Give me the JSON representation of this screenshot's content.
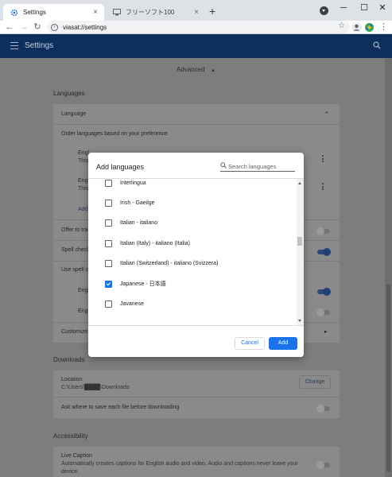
{
  "browser": {
    "tabs": [
      {
        "title": "Settings",
        "active": true
      },
      {
        "title": "フリーソフト100",
        "active": false
      }
    ],
    "new_tab": "+",
    "window": {
      "minimize": "─",
      "maximize": "☐",
      "close": "✕"
    },
    "nav": {
      "back": "←",
      "forward": "→",
      "reload": "↻"
    },
    "url": "viasat://settings",
    "info_glyph": "i",
    "star": "☆",
    "menu": "⋮"
  },
  "settings": {
    "app_title": "Settings",
    "advanced_label": "Advanced",
    "advanced_arrow": "▲",
    "languages_heading": "Languages",
    "language_label": "Language",
    "language_chevron": "⌃",
    "order_label": "Order languages based on your preference",
    "lang1_title": "Engl",
    "lang1_sub": "This",
    "lang2_title": "Engl",
    "lang2_sub": "This",
    "add_link": "Add",
    "offer_translate": "Offer to tra",
    "spell_check": "Spell check",
    "use_spell": "Use spell c",
    "spell_lang1": "Engl",
    "spell_lang2": "Engl",
    "customize": "Customize",
    "downloads_heading": "Downloads",
    "location_label": "Location",
    "location_path": "C:\\Users\\████\\Downloads",
    "change_button": "Change",
    "ask_where": "Ask where to save each file before downloading",
    "accessibility_heading": "Accessibility",
    "live_caption": "Live Caption",
    "live_caption_desc": "Automatically creates captions for English audio and video. Audio and captions never leave your",
    "live_caption_desc2": "device."
  },
  "dialog": {
    "title": "Add languages",
    "search_placeholder": "Search languages",
    "languages": [
      {
        "label": "Interlingua",
        "checked": false
      },
      {
        "label": "Irish - Gaeilge",
        "checked": false
      },
      {
        "label": "Italian - italiano",
        "checked": false
      },
      {
        "label": "Italian (Italy) - italiano (Italia)",
        "checked": false
      },
      {
        "label": "Italian (Switzerland) - italiano (Svizzera)",
        "checked": false
      },
      {
        "label": "Japanese - 日本語",
        "checked": true
      },
      {
        "label": "Javanese",
        "checked": false
      }
    ],
    "cancel": "Cancel",
    "add": "Add"
  },
  "colors": {
    "accent": "#1a73e8",
    "app_bar": "#0d2f5e"
  }
}
